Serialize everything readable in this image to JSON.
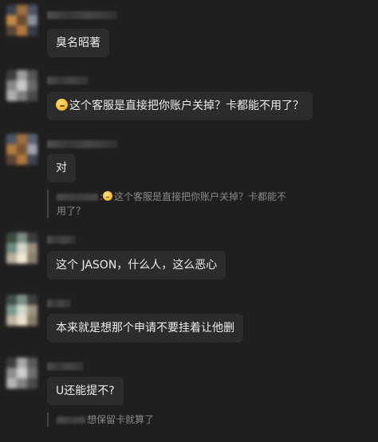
{
  "messages": [
    {
      "text": "臭名昭著"
    },
    {
      "text": "这个客服是直接把你账户关掉？卡都能不用了？",
      "emoji": "face-with-hand-over-mouth-icon"
    },
    {
      "text": "对",
      "quote": {
        "text_line1": "这个客服是直接把你账户关掉？卡都能不",
        "text_line2": "用了？",
        "sep": ":"
      }
    },
    {
      "text": "这个 JASON，什么人，这么恶心"
    },
    {
      "text": "本来就是想那个申请不要挂着让他删"
    },
    {
      "text": "U还能提不?",
      "quote": {
        "text": "想保留卡就算了"
      }
    }
  ]
}
